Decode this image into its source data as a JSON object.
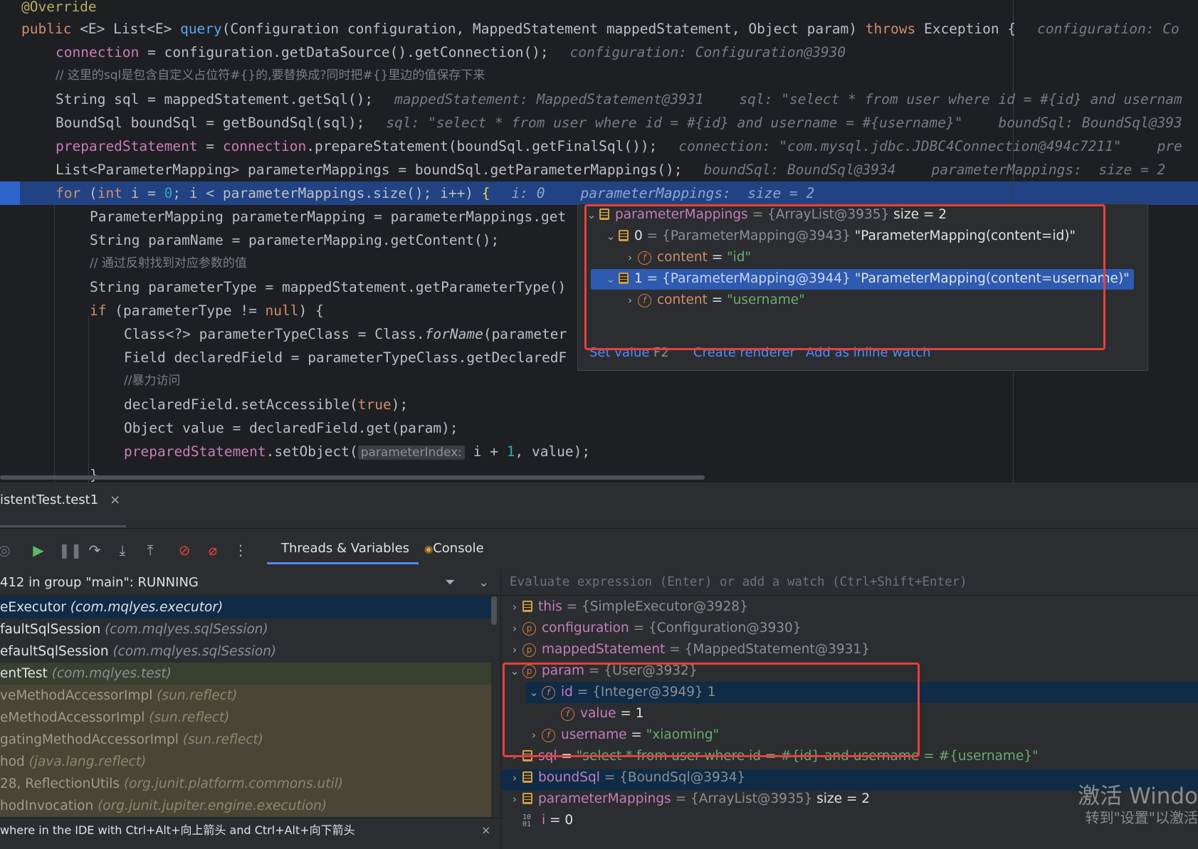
{
  "editor": {
    "lines": {
      "l0": "@Override",
      "l1a": "public ",
      "l1b": "<E> List<E> ",
      "l1c": "query",
      "l1d": "(Configuration configuration, MappedStatement mappedStatement, Object param) ",
      "l1e": "throws",
      "l1f": " Exception {",
      "l1h": "configuration: Co",
      "l2a": "connection",
      "l2b": " = configuration.getDataSource().getConnection();",
      "l2h": "configuration: Configuration@3930",
      "l3": "// 这里的sql是包含自定义占位符#{}的,要替换成?同时把#{}里边的值保存下来",
      "l4a": "String sql = mappedStatement.getSql();",
      "l4h1": "mappedStatement: MappedStatement@3931",
      "l4h2": "sql: \"select * from user where id = #{id} and usernam",
      "l5a": "BoundSql boundSql = getBoundSql(sql);",
      "l5h1": "sql: \"select * from user where id = #{id} and username = #{username}\"",
      "l5h2": "boundSql: BoundSql@393",
      "l6a": "preparedStatement",
      "l6b": " = ",
      "l6c": "connection",
      "l6d": ".prepareStatement(boundSql.getFinalSql());",
      "l6h1": "connection: \"com.mysql.jdbc.JDBC4Connection@494c7211\"",
      "l6h2": "pre",
      "l7a": "List<ParameterMapping> parameterMappings = boundSql.getParameterMappings();",
      "l7h1": "boundSql: BoundSql@3934",
      "l7h2": "parameterMappings:  size = 2",
      "l8a": "for",
      "l8b": " (",
      "l8c": "int",
      "l8d": " i = ",
      "l8e": "0",
      "l8f": "; i < parameterMappings.size(); i++) ",
      "l8g": "{",
      "l8h1": "i: 0",
      "l8h2": "parameterMappings:  size = 2",
      "l9": "ParameterMapping parameterMapping = parameterMappings.get",
      "l10": "String paramName = parameterMapping.getContent();",
      "l11": "// 通过反射找到对应参数的值",
      "l12": "String parameterType = mappedStatement.getParameterType()",
      "l13a": "if",
      "l13b": " (parameterType != ",
      "l13c": "null",
      "l13d": ") {",
      "l14a": "Class<?> parameterTypeClass = Class.",
      "l14b": "forName",
      "l14c": "(parameter",
      "l15": "Field declaredField = parameterTypeClass.getDeclaredF",
      "l16": "//暴力访问",
      "l17a": "declaredField.setAccessible(",
      "l17b": "true",
      "l17c": ");",
      "l18": "Object value = declaredField.get(param);",
      "l19a": "preparedStatement",
      "l19b": ".setObject(",
      "l19c": "parameterIndex:",
      "l19d": " i + ",
      "l19e": "1",
      "l19f": ", value);",
      "l20": "}"
    }
  },
  "popup": {
    "root_name": "parameterMappings",
    "root_val": " = {ArrayList@3935}",
    "root_size": " size = 2",
    "item0_idx": "0",
    "item0_val": " = {ParameterMapping@3943}",
    "item0_str": " \"ParameterMapping(content=id)\"",
    "item0_child_name": "content",
    "item0_child_eq": " = ",
    "item0_child_val": "\"id\"",
    "item1_idx": "1",
    "item1_val": " = {ParameterMapping@3944}",
    "item1_str": " \"ParameterMapping(content=username)\"",
    "item1_child_name": "content",
    "item1_child_eq": " = ",
    "item1_child_val": "\"username\"",
    "set_value": "Set value",
    "set_value_key": "F2",
    "create_renderer": "Create renderer",
    "add_inline_watch": "Add as inline watch"
  },
  "debug": {
    "run_tab": "istentTest.test1",
    "tab_close": "×",
    "subtab_threads": "Threads & Variables",
    "subtab_console": "Console",
    "thread_header": "412 in group \"main\": RUNNING",
    "frames": [
      {
        "name": "eExecutor ",
        "pkg": "(com.mqlyes.executor)"
      },
      {
        "name": "faultSqlSession ",
        "pkg": "(com.mqlyes.sqlSession)"
      },
      {
        "name": "efaultSqlSession ",
        "pkg": "(com.mqlyes.sqlSession)"
      },
      {
        "name": "entTest ",
        "pkg": "(com.mqlyes.test)"
      },
      {
        "name": "veMethodAccessorImpl ",
        "pkg": "(sun.reflect)"
      },
      {
        "name": "eMethodAccessorImpl ",
        "pkg": "(sun.reflect)"
      },
      {
        "name": "gatingMethodAccessorImpl ",
        "pkg": "(sun.reflect)"
      },
      {
        "name": "hod ",
        "pkg": "(java.lang.reflect)"
      },
      {
        "name": "28, ReflectionUtils ",
        "pkg": "(org.junit.platform.commons.util)"
      },
      {
        "name": "hodInvocation ",
        "pkg": "(org.junit.jupiter.engine.execution)"
      }
    ],
    "hint": "where in the IDE with Ctrl+Alt+向上箭头 and Ctrl+Alt+向下箭头",
    "eval_placeholder": "Evaluate expression (Enter) or add a watch (Ctrl+Shift+Enter)",
    "vars": {
      "this_name": "this",
      "this_val": " = {SimpleExecutor@3928}",
      "conf_name": "configuration",
      "conf_val": " = {Configuration@3930}",
      "ms_name": "mappedStatement",
      "ms_val": " = {MappedStatement@3931}",
      "param_name": "param",
      "param_val": " = {User@3932}",
      "id_name": "id",
      "id_val": " = {Integer@3949} 1",
      "value_name": "value",
      "value_val": " = 1",
      "username_name": "username",
      "username_eq": " = ",
      "username_val": "\"xiaoming\"",
      "sql_name": "sql",
      "sql_eq": " = ",
      "sql_val": "\"select * from user where id = #{id} and username = #{username}\"",
      "bs_name": "boundSql",
      "bs_val": " = {BoundSql@3934}",
      "pm_name": "parameterMappings",
      "pm_val": " = {ArrayList@3935}",
      "pm_size": " size = 2",
      "i_name": "i",
      "i_val": " = 0"
    },
    "icons": {
      "p": "p",
      "f": "f"
    }
  },
  "watermark": {
    "line1": "激活 Windo",
    "line2": "转到\"设置\"以激活"
  }
}
